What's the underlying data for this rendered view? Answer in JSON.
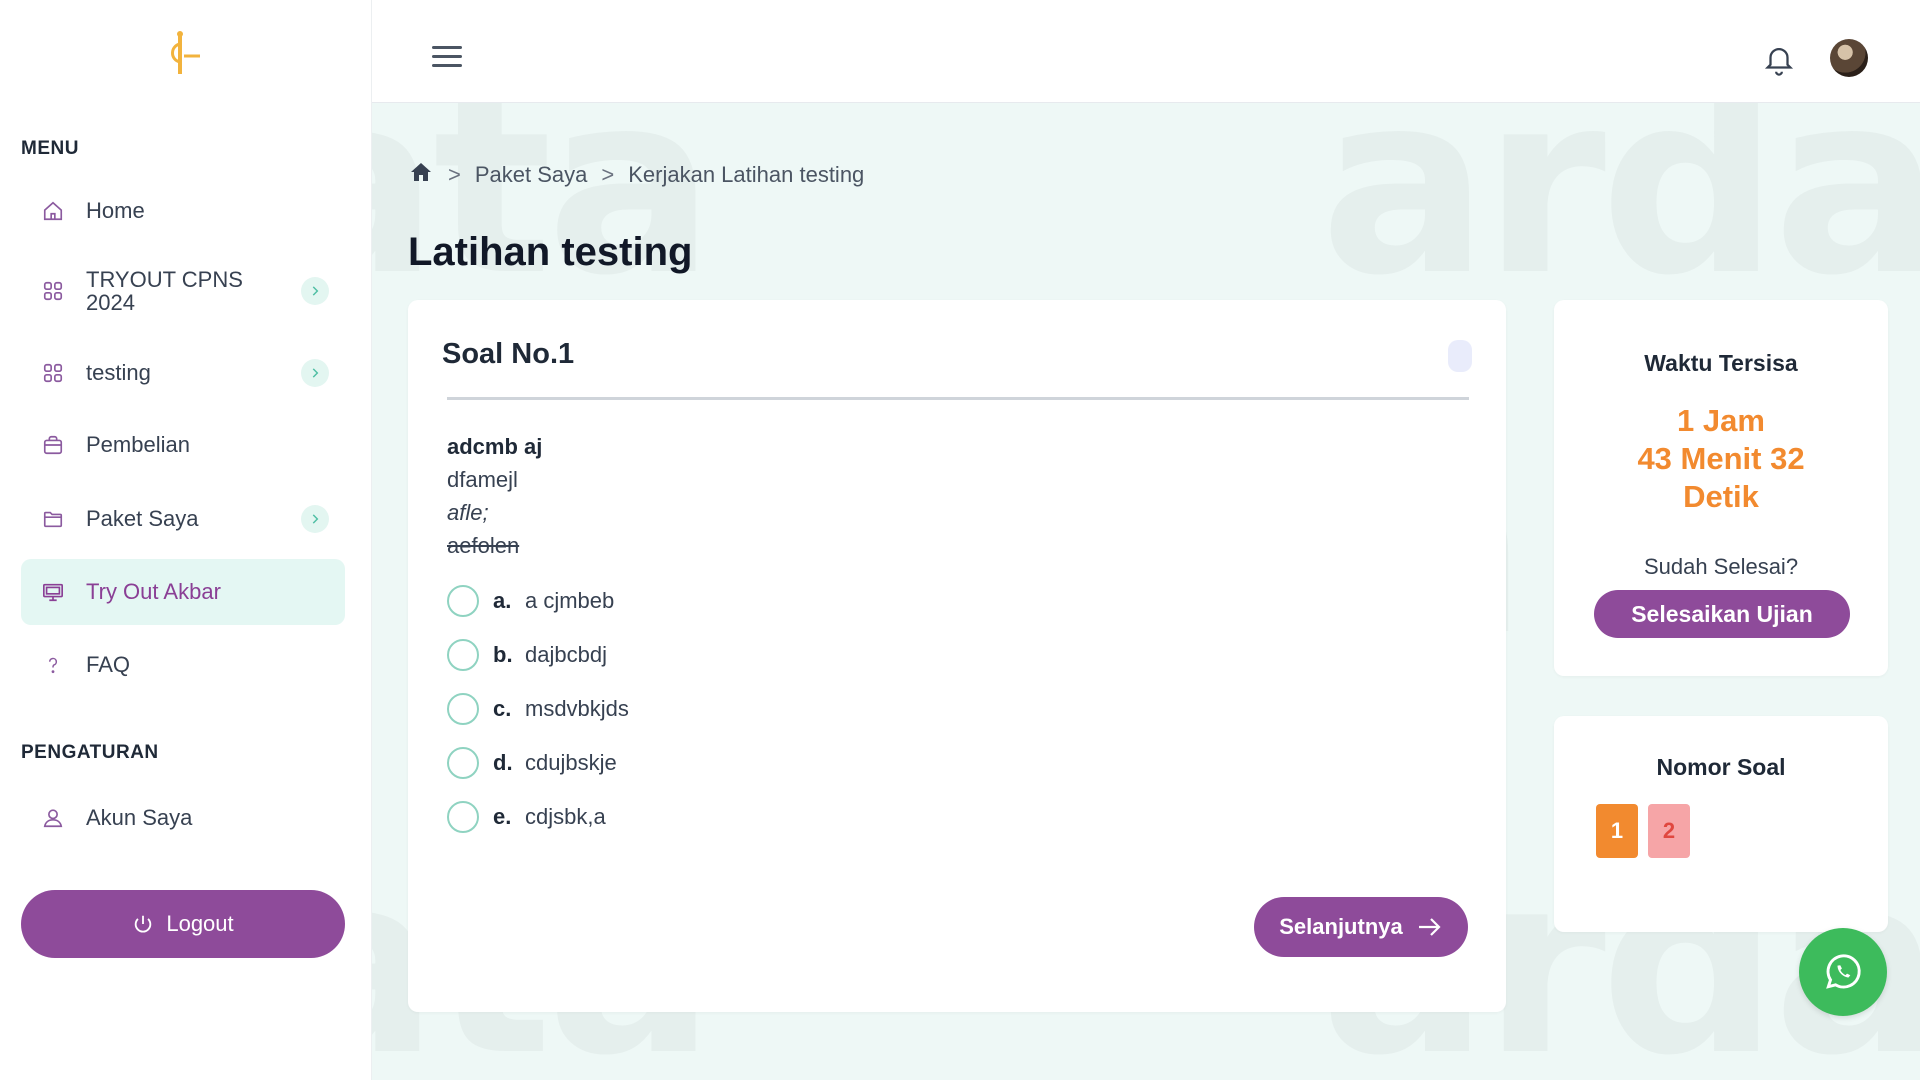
{
  "sidebar": {
    "menu_title": "MENU",
    "settings_title": "PENGATURAN",
    "items": [
      {
        "label": "Home",
        "icon": "home-icon"
      },
      {
        "label": "TRYOUT CPNS 2024",
        "icon": "grid-icon"
      },
      {
        "label": "testing",
        "icon": "grid-icon"
      },
      {
        "label": "Pembelian",
        "icon": "shopping-bag-icon"
      },
      {
        "label": "Paket Saya",
        "icon": "folder-icon"
      },
      {
        "label": "Try Out Akbar",
        "icon": "monitor-icon"
      },
      {
        "label": "FAQ",
        "icon": "question-icon"
      }
    ],
    "settings_items": [
      {
        "label": "Akun Saya",
        "icon": "user-icon"
      }
    ],
    "logout_label": "Logout"
  },
  "breadcrumb": {
    "sep": ">",
    "paket": "Paket Saya",
    "current": "Kerjakan Latihan testing"
  },
  "page_title": "Latihan testing",
  "question": {
    "title": "Soal No.1",
    "lines": {
      "bold": "adcmb aj",
      "normal": "dfamejl",
      "italic": "afle;",
      "strike": "aefolen"
    },
    "options": [
      {
        "letter": "a.",
        "text": "a cjmbeb"
      },
      {
        "letter": "b.",
        "text": "dajbcbdj"
      },
      {
        "letter": "c.",
        "text": "msdvbkjds"
      },
      {
        "letter": "d.",
        "text": "cdujbskje"
      },
      {
        "letter": "e.",
        "text": "cdjsbk,a"
      }
    ],
    "next_label": "Selanjutnya"
  },
  "timer": {
    "title": "Waktu Tersisa",
    "line1": "1 Jam",
    "line2": "43 Menit 32",
    "line3": "Detik",
    "done_question": "Sudah Selesai?",
    "finish_label": "Selesaikan Ujian"
  },
  "nomor": {
    "title": "Nomor Soal",
    "numbers": [
      "1",
      "2"
    ]
  },
  "colors": {
    "primary": "#8e4b9a",
    "accent_orange": "#f28a2f",
    "teal_light": "#e4f7f3",
    "whatsapp": "#3dbb5c"
  }
}
